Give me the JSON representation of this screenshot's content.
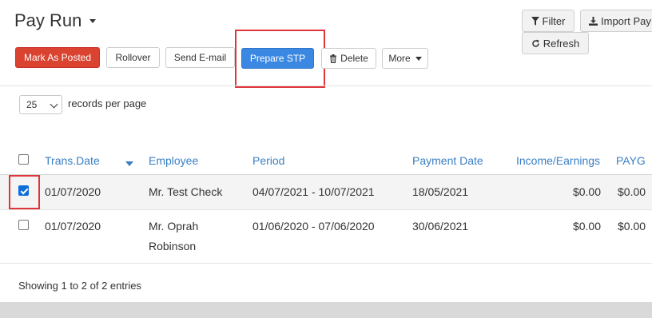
{
  "page": {
    "title": "Pay Run"
  },
  "toolbar": {
    "mark_posted": "Mark As Posted",
    "rollover": "Rollover",
    "send_email": "Send E-mail",
    "prepare_stp": "Prepare STP",
    "delete": "Delete",
    "more": "More",
    "filter": "Filter",
    "import_pay": "Import Pay",
    "refresh": "Refresh"
  },
  "paging": {
    "page_size": "25",
    "label": "records per page"
  },
  "table": {
    "columns": [
      "Trans.Date",
      "Employee",
      "Period",
      "Payment Date",
      "Income/Earnings",
      "PAYG"
    ],
    "rows": [
      {
        "checked": true,
        "trans_date": "01/07/2020",
        "employee": "Mr. Test Check",
        "employee_line2": "",
        "period": "04/07/2021 - 10/07/2021",
        "payment_date": "18/05/2021",
        "income": "$0.00",
        "payg": "$0.00"
      },
      {
        "checked": false,
        "trans_date": "01/07/2020",
        "employee": "Mr. Oprah",
        "employee_line2": "Robinson",
        "period": "01/06/2020 - 07/06/2020",
        "payment_date": "30/06/2021",
        "income": "$0.00",
        "payg": "$0.00"
      }
    ]
  },
  "footer": {
    "info": "Showing 1 to 2 of 2 entries"
  },
  "colors": {
    "danger": "#d9432f",
    "primary": "#3b88e3",
    "link": "#3a7fc4",
    "highlight": "#e0353a"
  }
}
